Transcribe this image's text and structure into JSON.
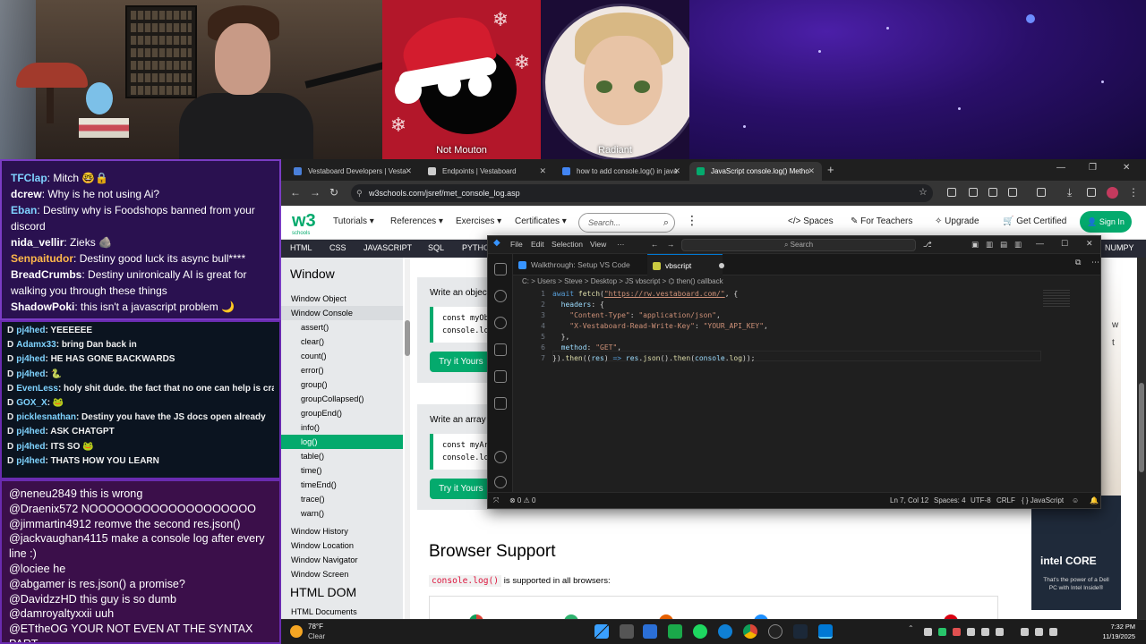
{
  "stream": {
    "guest1_name": "Not Mouton",
    "guest2_name": "Radiant"
  },
  "chat_top": [
    {
      "user": "TFClap",
      "color": "#7fd3ff",
      "text": "Mitch 🤓🔒"
    },
    {
      "user": "dcrew",
      "color": "#ffffff",
      "text": "Why is he not using Ai?"
    },
    {
      "user": "Eban",
      "color": "#7fd3ff",
      "text": "Destiny why is Foodshops banned from your discord"
    },
    {
      "user": "nida_vellir",
      "color": "#ffffff",
      "text": "Zieks 🪨"
    },
    {
      "user": "Senpaitudor",
      "color": "#ffb84a",
      "text": "Destiny good luck its async bull****"
    },
    {
      "user": "BreadCrumbs",
      "color": "#ffffff",
      "text": "Destiny unironically AI is great for walking you through these things"
    },
    {
      "user": "ShadowPoki",
      "color": "#ffffff",
      "text": "this isn't a javascript problem 🌙"
    }
  ],
  "chat_mid": [
    {
      "user": "pj4hed",
      "text": "YEEEEEE"
    },
    {
      "user": "Adamx33",
      "text": "bring Dan back in"
    },
    {
      "user": "pj4hed",
      "text": "HE HAS GONE BACKWARDS"
    },
    {
      "user": "pj4hed",
      "text": "🐍"
    },
    {
      "user": "EvenLess",
      "text": "holy shit dude. the fact that no one can help is crazy. just open up an LLM"
    },
    {
      "user": "GOX_X",
      "text": "🐸"
    },
    {
      "user": "picklesnathan",
      "text": "Destiny you have the JS docs open already"
    },
    {
      "user": "pj4hed",
      "text": "ASK CHATGPT"
    },
    {
      "user": "pj4hed",
      "text": "ITS SO 🐸"
    },
    {
      "user": "pj4hed",
      "text": "THATS HOW YOU LEARN"
    }
  ],
  "chat_bot": [
    {
      "user": "@neneu2849",
      "text": "this is wrong"
    },
    {
      "user": "@Draenix572",
      "text": "NOOOOOOOOOOOOOOOOOOO"
    },
    {
      "user": "@jimmartin4912",
      "text": "reomve the second res.json()"
    },
    {
      "user": "@jackvaughan4115",
      "text": "make a console log after every line :)"
    },
    {
      "user": "@lociee",
      "text": "he"
    },
    {
      "user": "@abgamer",
      "text": "is res.json() a promise?"
    },
    {
      "user": "@DavidzzHD",
      "text": "this guy is so dumb"
    },
    {
      "user": "@damroyaltyxxii",
      "text": "uuh"
    },
    {
      "user": "@ETtheOG",
      "text": "YOUR NOT EVEN AT THE SYNTAX PART"
    }
  ],
  "browser": {
    "tabs": [
      {
        "label": "Vestaboard Developers | Vesta",
        "icon_color": "#4a7fd9"
      },
      {
        "label": "Endpoints | Vestaboard",
        "icon_color": "#cccccc"
      },
      {
        "label": "how to add console.log() in java",
        "icon_color": "#4285f4"
      },
      {
        "label": "JavaScript console.log() Metho",
        "icon_color": "#04aa6d"
      }
    ],
    "url": "w3schools.com/jsref/met_console_log.asp"
  },
  "w3": {
    "logo": "w3",
    "logo_sub": "schools",
    "menu": [
      "Tutorials ▾",
      "References ▾",
      "Exercises ▾",
      "Certificates ▾"
    ],
    "search_placeholder": "Search...",
    "right_menu": [
      "Spaces",
      "For Teachers",
      "Upgrade",
      "Get Certified"
    ],
    "signin": "Sign In",
    "topics": [
      "HTML",
      "CSS",
      "JAVASCRIPT",
      "SQL",
      "PYTHON",
      "NUMPY"
    ],
    "sidebar_heading": "Window",
    "sidebar": [
      {
        "label": "Window Object",
        "kind": "top"
      },
      {
        "label": "Window Console",
        "kind": "open"
      },
      {
        "label": "assert()",
        "kind": "sub"
      },
      {
        "label": "clear()",
        "kind": "sub"
      },
      {
        "label": "count()",
        "kind": "sub"
      },
      {
        "label": "error()",
        "kind": "sub"
      },
      {
        "label": "group()",
        "kind": "sub"
      },
      {
        "label": "groupCollapsed()",
        "kind": "sub"
      },
      {
        "label": "groupEnd()",
        "kind": "sub"
      },
      {
        "label": "info()",
        "kind": "sub"
      },
      {
        "label": "log()",
        "kind": "active"
      },
      {
        "label": "table()",
        "kind": "sub"
      },
      {
        "label": "time()",
        "kind": "sub"
      },
      {
        "label": "timeEnd()",
        "kind": "sub"
      },
      {
        "label": "trace()",
        "kind": "sub"
      },
      {
        "label": "warn()",
        "kind": "sub"
      },
      {
        "label": "Window History",
        "kind": "top"
      },
      {
        "label": "Window Location",
        "kind": "top"
      },
      {
        "label": "Window Navigator",
        "kind": "top"
      },
      {
        "label": "Window Screen",
        "kind": "top"
      }
    ],
    "sidebar_heading2": "HTML DOM",
    "sidebar_last": "HTML Documents",
    "example1": {
      "title": "Write an objec",
      "code": [
        "const myOb",
        "console.log"
      ],
      "button": "Try it Yours"
    },
    "example2": {
      "title": "Write an array",
      "code": [
        "const myAr",
        "console.log"
      ],
      "button": "Try it Yours"
    },
    "browser_support_title": "Browser Support",
    "browser_support_code": "console.log()",
    "browser_support_text": "is supported in all browsers:",
    "ad_brand": "intel CORE",
    "ad_text": "That's the power of a Dell PC with Intel Inside®"
  },
  "vscode": {
    "menus": [
      "File",
      "Edit",
      "Selection",
      "View",
      "···"
    ],
    "search": "Search",
    "tabs": [
      "Walkthrough: Setup VS Code",
      "vbscript"
    ],
    "breadcrumb": "C: > Users > Steve > Desktop > JS vbscript > ⌬ then() callback",
    "code": [
      {
        "n": "1",
        "html": "<span class='k'>await</span> <span class='f'>fetch</span>(<span class='lnk'>\"https://rw.vestaboard.com/\"</span>, {"
      },
      {
        "n": "2",
        "html": "  <span class='p'>headers</span>: {"
      },
      {
        "n": "3",
        "html": "    <span class='s'>\"Content-Type\"</span>: <span class='s'>\"application/json\"</span>,"
      },
      {
        "n": "4",
        "html": "    <span class='s'>\"X-Vestaboard-Read-Write-Key\"</span>: <span class='s'>\"YOUR_API_KEY\"</span>,"
      },
      {
        "n": "5",
        "html": "  },"
      },
      {
        "n": "6",
        "html": "  <span class='p'>method</span>: <span class='s'>\"GET\"</span>,"
      },
      {
        "n": "7",
        "html": "}).<span class='f'>then</span>((<span class='p'>res</span>) <span class='k'>=></span> <span class='p'>res</span>.<span class='f'>json</span>().<span class='f'>then</span>(<span class='p'>console</span>.<span class='f'>log</span>));"
      }
    ],
    "status_left": "⊗ 0 ⚠ 0",
    "status_right": [
      "Ln 7, Col 12",
      "Spaces: 4",
      "UTF-8",
      "CRLF",
      "{ } JavaScript"
    ]
  },
  "taskbar": {
    "temp": "78°F",
    "weather": "Clear",
    "time": "7:32 PM",
    "date": "11/19/2025"
  }
}
